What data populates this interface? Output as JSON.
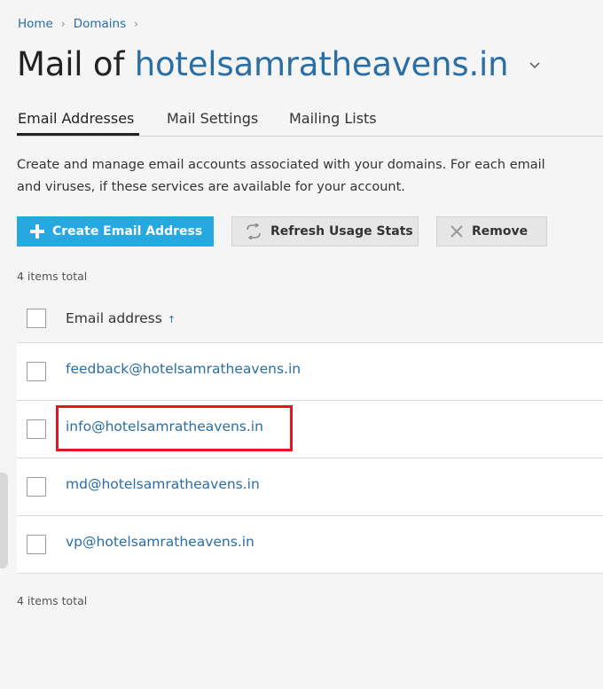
{
  "breadcrumb": {
    "items": [
      "Home",
      "Domains"
    ],
    "separator": ">"
  },
  "title": {
    "prefix": "Mail of",
    "domain": "hotelsamratheavens.in",
    "dropdown_icon": "chevron-down-icon"
  },
  "tabs": [
    {
      "label": "Email Addresses",
      "active": true
    },
    {
      "label": "Mail Settings",
      "active": false
    },
    {
      "label": "Mailing Lists",
      "active": false
    }
  ],
  "description": {
    "line1": "Create and manage email accounts associated with your domains. For each email",
    "line2": "and viruses, if these services are available for your account."
  },
  "toolbar": {
    "create_label": "Create Email Address",
    "refresh_label": "Refresh Usage Stats",
    "remove_label": "Remove"
  },
  "items_total_top": "4 items total",
  "items_total_bottom": "4 items total",
  "table": {
    "header": "Email address",
    "sort_indicator": "↑",
    "rows": [
      "feedback@hotelsamratheavens.in",
      "info@hotelsamratheavens.in",
      "md@hotelsamratheavens.in",
      "vp@hotelsamratheavens.in"
    ]
  },
  "colors": {
    "link": "#2a6ea3",
    "primary_button": "#28a8e0",
    "highlight": "#e8141b",
    "background": "#f5f5f5"
  }
}
